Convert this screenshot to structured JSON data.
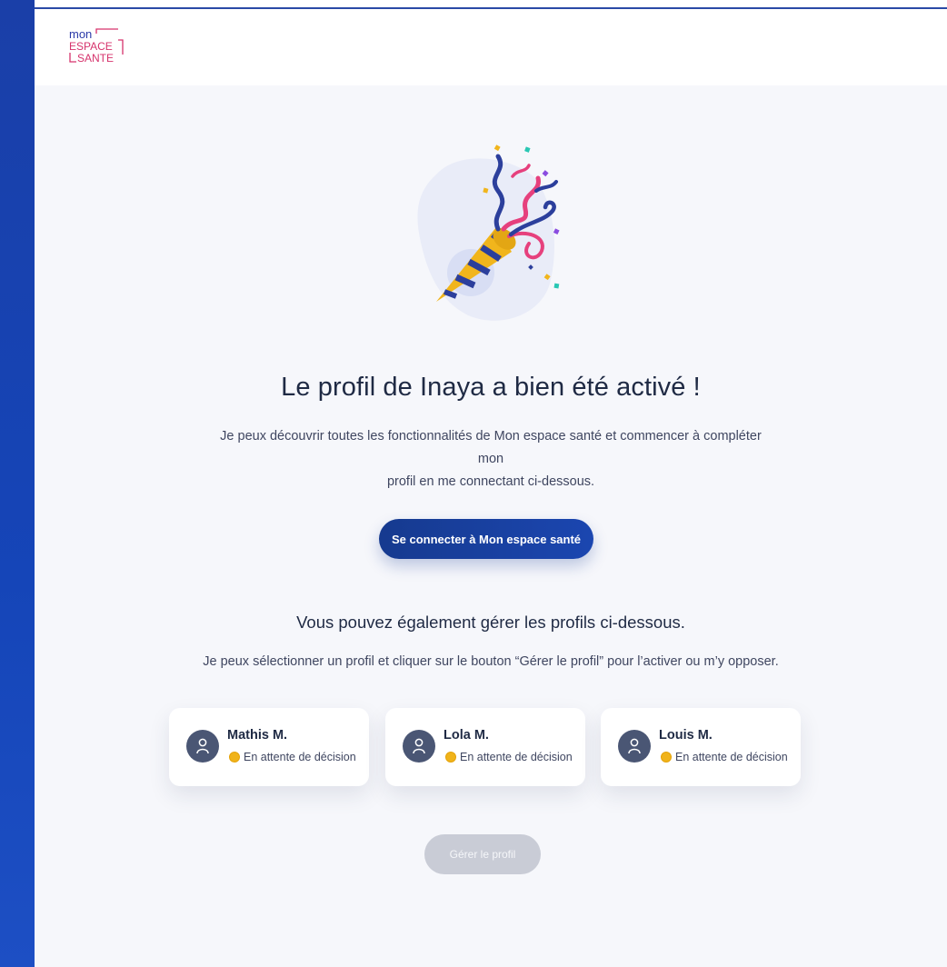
{
  "brand": {
    "logo_lines": [
      "mon",
      "ESPACE",
      "SANTE"
    ],
    "colors": {
      "primary_blue": "#1a3fa8",
      "logo_pink": "#d6336c",
      "logo_blue": "#2b3aa8",
      "status_pending": "#f0b31a",
      "disabled_button": "#c9ccd6"
    }
  },
  "main": {
    "title": "Le profil de Inaya a bien été activé !",
    "intro_line1": "Je peux découvrir toutes les fonctionnalités de Mon espace santé et commencer à compléter mon",
    "intro_line2": "profil en me connectant ci-dessous.",
    "connect_button_label": "Se connecter à Mon espace santé",
    "subtitle": "Vous pouvez également gérer les profils ci-dessous.",
    "subtext": "Je peux sélectionner un profil et cliquer sur le bouton “Gérer le profil” pour l’activer ou m’y opposer.",
    "profiles": [
      {
        "name": "Mathis M.",
        "status": "En attente de décision",
        "icon": "user-icon"
      },
      {
        "name": "Lola M.",
        "status": "En attente de décision",
        "icon": "user-icon"
      },
      {
        "name": "Louis M.",
        "status": "En attente de décision",
        "icon": "user-icon"
      }
    ],
    "manage_button_label": "Gérer le profil",
    "illustration": "party-popper-icon"
  }
}
